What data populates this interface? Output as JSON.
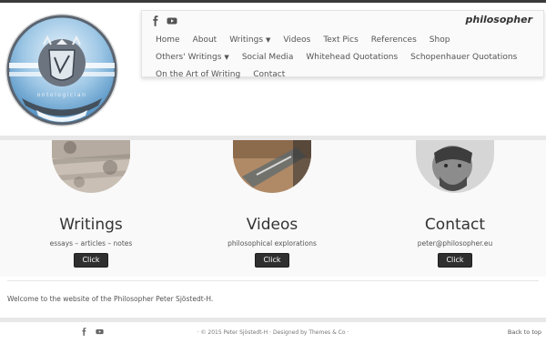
{
  "header": {
    "site_title": "philosopher",
    "logo_text": "ontologician",
    "social": [
      "facebook-icon",
      "youtube-icon"
    ]
  },
  "nav": {
    "row1": [
      {
        "label": "Home",
        "dropdown": false
      },
      {
        "label": "About",
        "dropdown": false
      },
      {
        "label": "Writings",
        "dropdown": true
      },
      {
        "label": "Videos",
        "dropdown": false
      },
      {
        "label": "Text Pics",
        "dropdown": false
      },
      {
        "label": "References",
        "dropdown": false
      },
      {
        "label": "Shop",
        "dropdown": false
      }
    ],
    "row2": [
      {
        "label": "Others' Writings",
        "dropdown": true
      },
      {
        "label": "Social Media",
        "dropdown": false
      },
      {
        "label": "Whitehead Quotations",
        "dropdown": false
      },
      {
        "label": "Schopenhauer Quotations",
        "dropdown": false
      }
    ],
    "row3": [
      {
        "label": "On the Art of Writing",
        "dropdown": false
      },
      {
        "label": "Contact",
        "dropdown": false
      }
    ]
  },
  "features": [
    {
      "heading": "Writings",
      "sub": "essays – articles – notes",
      "button": "Click"
    },
    {
      "heading": "Videos",
      "sub": "philosophical explorations",
      "button": "Click"
    },
    {
      "heading": "Contact",
      "sub": "peter@philosopher.eu",
      "button": "Click"
    }
  ],
  "welcome": "Welcome to the website of the Philosopher Peter Sjöstedt-H.",
  "footer": {
    "copyright": "· © 2015 Peter Sjöstedt-H · Designed by Themes & Co ·",
    "back_to_top": "Back to top"
  },
  "colors": {
    "button_bg": "#2f2f2f",
    "divider": "#e8e8e8",
    "logo_blue": "#8fc1e4"
  }
}
